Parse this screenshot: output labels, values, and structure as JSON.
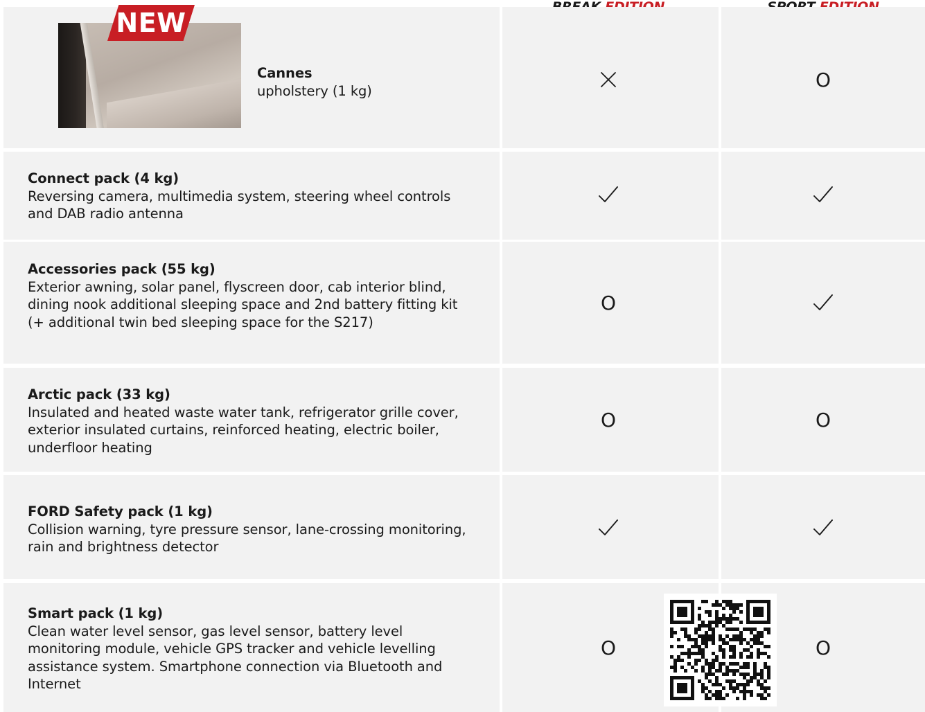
{
  "header": {
    "col1": {
      "word": "BREAK",
      "edition": "EDITION"
    },
    "col2": {
      "word": "SPORT",
      "edition": "EDITION"
    }
  },
  "badge": {
    "label": "NEW"
  },
  "colors": {
    "accent": "#c81e24",
    "cell": "#f2f2f2",
    "text": "#1a1a1a"
  },
  "legend_marks": {
    "check": "check-icon",
    "option": "O",
    "unavailable": "cross-icon"
  },
  "rows": [
    {
      "title": "Cannes",
      "body": "upholstery (1 kg)",
      "break": "x",
      "sport": "O"
    },
    {
      "title": "Connect pack (4 kg)",
      "body": "Reversing camera, multimedia system, steering wheel controls and DAB radio antenna",
      "break": "check",
      "sport": "check"
    },
    {
      "title": "Accessories pack (55 kg)",
      "body": "Exterior awning, solar panel, flyscreen door, cab interior blind, dining nook additional sleeping space and 2nd battery fitting kit (+ additional twin bed sleeping space for the S217)",
      "break": "O",
      "sport": "check"
    },
    {
      "title": "Arctic pack (33 kg)",
      "body": "Insulated and heated waste water tank, refrigerator grille cover, exterior insulated curtains, reinforced heating, electric boiler, underfloor heating",
      "break": "O",
      "sport": "O"
    },
    {
      "title": "FORD Safety pack (1 kg)",
      "body": "Collision warning, tyre pressure sensor, lane-crossing monitoring, rain and brightness detector",
      "break": "check",
      "sport": "check"
    },
    {
      "title": "Smart pack (1 kg)",
      "body": "Clean water level sensor, gas level sensor, battery level monitoring module, vehicle GPS tracker and vehicle levelling assistance system. Smartphone connection via Bluetooth and Internet",
      "break": "O",
      "sport": "O"
    }
  ]
}
